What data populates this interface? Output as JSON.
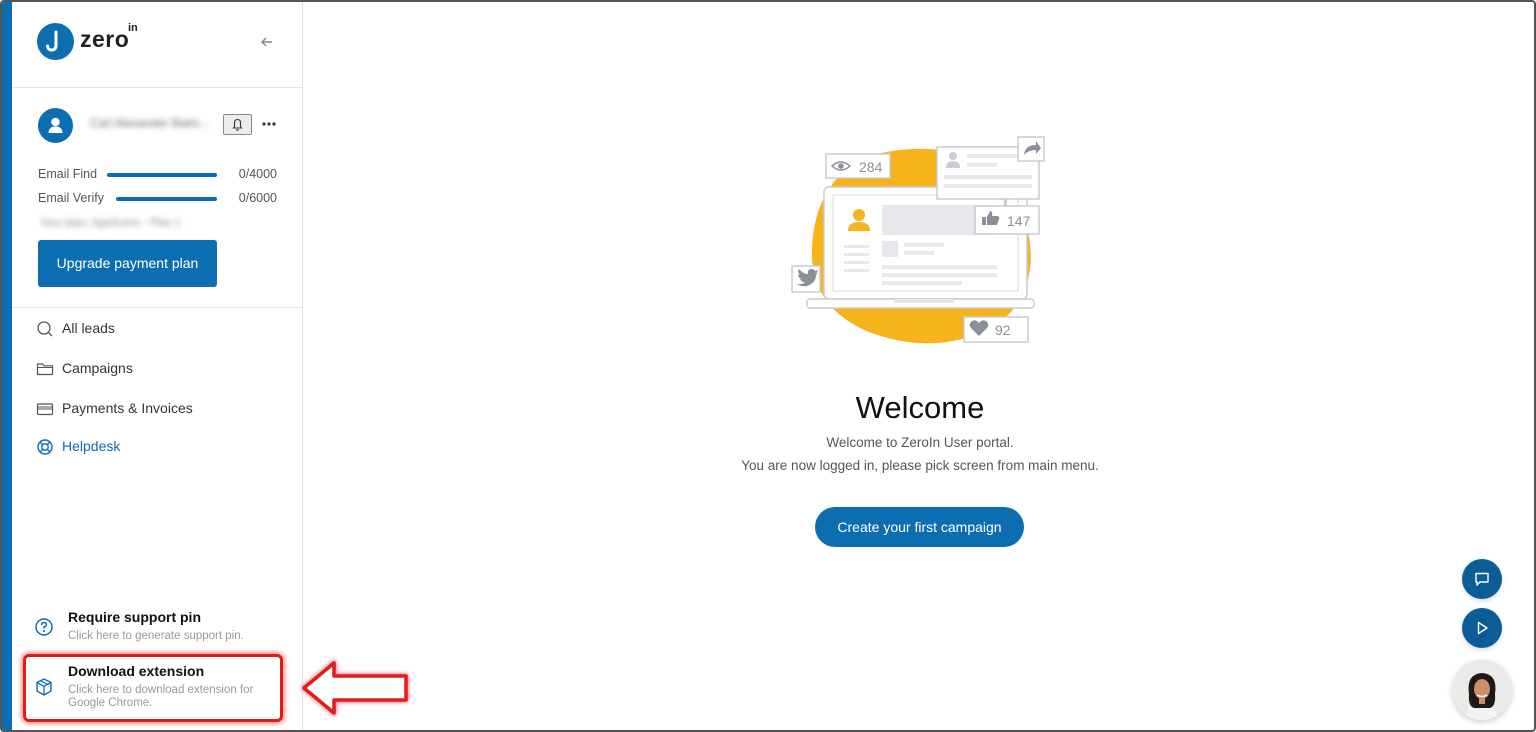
{
  "app": {
    "logo_text": "zero",
    "logo_superscript": "in"
  },
  "sidebar": {
    "collapse_icon": "arrow-left-icon",
    "user": {
      "name": "Carl Alexander Balm...",
      "notifications_icon": "bell-icon",
      "more_icon": "more-icon"
    },
    "usage": [
      {
        "label": "Email Find",
        "count": "0/4000",
        "used_fraction": 0.0
      },
      {
        "label": "Email Verify",
        "count": "0/6000",
        "used_fraction": 0.0
      }
    ],
    "plan_text": "Your plan: AppSumo - Plan 1",
    "upgrade_label": "Upgrade payment plan",
    "nav": [
      {
        "label": "All leads",
        "icon": "search-icon",
        "active": false
      },
      {
        "label": "Campaigns",
        "icon": "folder-icon",
        "active": false
      },
      {
        "label": "Payments & Invoices",
        "icon": "credit-card-icon",
        "active": false
      },
      {
        "label": "Helpdesk",
        "icon": "lifebuoy-icon",
        "active": true
      }
    ],
    "support_pin": {
      "title": "Require support pin",
      "subtitle": "Click here to generate support pin.",
      "icon": "question-circle-icon"
    },
    "download_extension": {
      "title": "Download extension",
      "subtitle": "Click here to download extension for Google Chrome.",
      "icon": "box-icon"
    }
  },
  "main": {
    "illustration": {
      "views": "284",
      "likes": "147",
      "hearts": "92"
    },
    "title": "Welcome",
    "subtitle_line1": "Welcome to ZeroIn User portal.",
    "subtitle_line2": "You are now logged in, please pick screen from main menu.",
    "cta_label": "Create your first campaign"
  },
  "floating": {
    "chat_icon": "chat-icon",
    "play_icon": "play-icon",
    "support_avatar": "support-agent-avatar"
  },
  "colors": {
    "brand": "#0c6db0",
    "illustration_accent": "#f7b31b",
    "callout_red": "#e01b1b"
  }
}
